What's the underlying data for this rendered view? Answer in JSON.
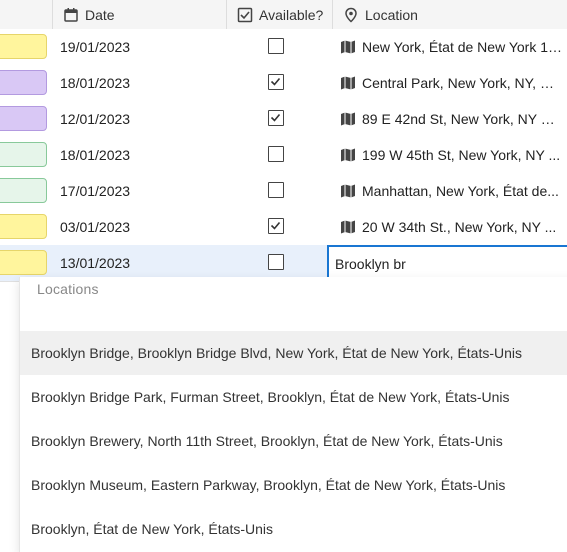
{
  "header": {
    "date_label": "Date",
    "available_label": "Available?",
    "location_label": "Location"
  },
  "rows": [
    {
      "chip_color": "#fff59d",
      "chip_border": "#e6d56a",
      "date": "19/01/2023",
      "available": false,
      "location": "New York, État de New York 10..."
    },
    {
      "chip_color": "#d9c8f5",
      "chip_border": "#b39ae0",
      "date": "18/01/2023",
      "available": true,
      "location": "Central Park, New York, NY, État..."
    },
    {
      "chip_color": "#d9c8f5",
      "chip_border": "#b39ae0",
      "date": "12/01/2023",
      "available": true,
      "location": "89 E 42nd St, New York, NY 100..."
    },
    {
      "chip_color": "#e6f5ea",
      "chip_border": "#88c99a",
      "date": "18/01/2023",
      "available": false,
      "location": "199 W 45th St, New York, NY ..."
    },
    {
      "chip_color": "#e6f5ea",
      "chip_border": "#88c99a",
      "date": "17/01/2023",
      "available": false,
      "location": "Manhattan, New York, État de..."
    },
    {
      "chip_color": "#fff59d",
      "chip_border": "#e6d56a",
      "date": "03/01/2023",
      "available": true,
      "location": "20 W 34th St., New York, NY ..."
    },
    {
      "chip_color": "#fff59d",
      "chip_border": "#e6d56a",
      "date": "13/01/2023",
      "available": false,
      "location": ""
    }
  ],
  "editor": {
    "value": "Brooklyn br"
  },
  "dropdown": {
    "title": "Locations",
    "items": [
      "Brooklyn Bridge, Brooklyn Bridge Blvd, New York, État de New York, États-Unis",
      "Brooklyn Bridge Park, Furman Street, Brooklyn, État de New York, États-Unis",
      "Brooklyn Brewery, North 11th Street, Brooklyn, État de New York, États-Unis",
      "Brooklyn Museum, Eastern Parkway, Brooklyn, État de New York, États-Unis",
      "Brooklyn, État de New York, États-Unis"
    ],
    "highlighted_index": 0
  },
  "icons": {
    "date_header": "calendar-icon",
    "available_header": "checkbox-icon",
    "location_header": "location-pin-icon",
    "row_location": "map-icon"
  },
  "colors": {
    "accent": "#1976d2",
    "active_row": "#e8f0fb"
  }
}
